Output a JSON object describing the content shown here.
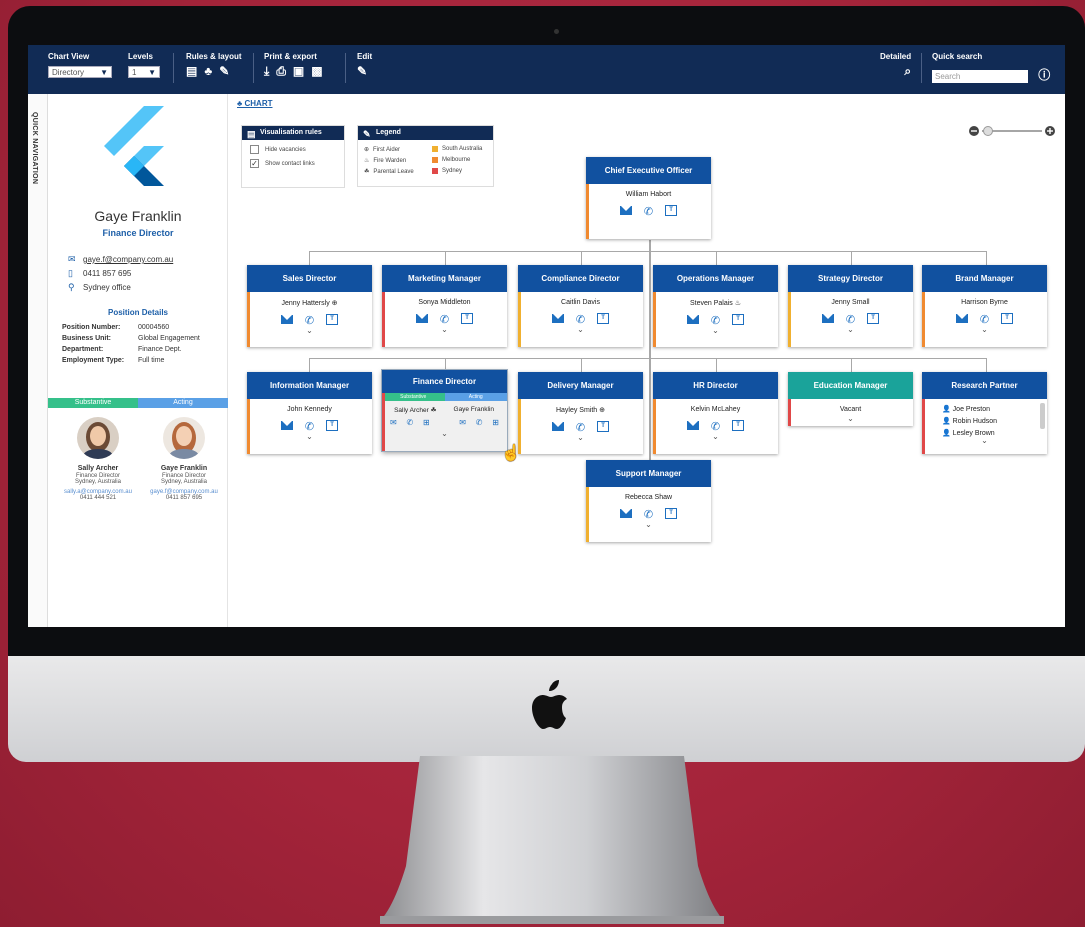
{
  "toolbar": {
    "chart_view_label": "Chart View",
    "chart_view_value": "Directory",
    "levels_label": "Levels",
    "levels_value": "1",
    "rules_label": "Rules & layout",
    "print_label": "Print & export",
    "edit_label": "Edit",
    "detailed_label": "Detailed",
    "quick_search_label": "Quick search",
    "search_placeholder": "Search"
  },
  "quick_nav": "QUICK NAVIGATION",
  "profile": {
    "name": "Gaye Franklin",
    "title": "Finance Director",
    "email": "gaye.f@company.com.au",
    "phone": "0411 857 695",
    "office": "Sydney office",
    "details_heading": "Position Details",
    "details": [
      {
        "label": "Position Number:",
        "value": "00004560"
      },
      {
        "label": "Business Unit:",
        "value": "Global Engagement"
      },
      {
        "label": "Department:",
        "value": "Finance Dept."
      },
      {
        "label": "Employment Type:",
        "value": "Full time"
      }
    ],
    "tab_substantive": "Substantive",
    "tab_acting": "Acting",
    "people": [
      {
        "name": "Sally Archer",
        "title": "Finance Director",
        "location": "Sydney, Australia",
        "email": "sally.a@company.com.au",
        "phone": "0411 444 521"
      },
      {
        "name": "Gaye Franklin",
        "title": "Finance Director",
        "location": "Sydney, Australia",
        "email": "gaye.f@company.com.au",
        "phone": "0411 857 695"
      }
    ]
  },
  "breadcrumb": "CHART",
  "vis_rules": {
    "title": "Visualisation rules",
    "hide": "Hide vacancies",
    "show": "Show contact links"
  },
  "legend": {
    "title": "Legend",
    "items": [
      "First Aider",
      "Fire Warden",
      "Parental Leave",
      "South Australia",
      "Melbourne",
      "Sydney"
    ]
  },
  "colors": {
    "south_australia": "#f0b030",
    "melbourne": "#f08a30",
    "sydney": "#e04848",
    "navy": "#112b55",
    "card_blue": "#1151a0",
    "teal": "#1aa39a"
  },
  "cards": [
    {
      "title": "Chief Executive Officer",
      "name": "William Habort"
    },
    {
      "title": "Sales Director",
      "name": "Jenny Hattersly"
    },
    {
      "title": "Marketing Manager",
      "name": "Sonya Middleton"
    },
    {
      "title": "Compliance Director",
      "name": "Caitlin Davis"
    },
    {
      "title": "Operations Manager",
      "name": "Steven Palais"
    },
    {
      "title": "Strategy Director",
      "name": "Jenny Small"
    },
    {
      "title": "Brand Manager",
      "name": "Harrison Byrne"
    },
    {
      "title": "Information Manager",
      "name": "John Kennedy"
    },
    {
      "title": "Finance Director",
      "name": "",
      "substantive": "Substantive",
      "acting": "Acting",
      "name_a": "Sally Archer",
      "name_b": "Gaye Franklin"
    },
    {
      "title": "Delivery Manager",
      "name": "Hayley Smith"
    },
    {
      "title": "HR Director",
      "name": "Kelvin McLahey"
    },
    {
      "title": "Education Manager",
      "name": "Vacant"
    },
    {
      "title": "Research Partner",
      "name": "",
      "members": [
        "Joe Preston",
        "Robin Hudson",
        "Lesley Brown"
      ]
    },
    {
      "title": "Support Manager",
      "name": "Rebecca Shaw"
    }
  ]
}
